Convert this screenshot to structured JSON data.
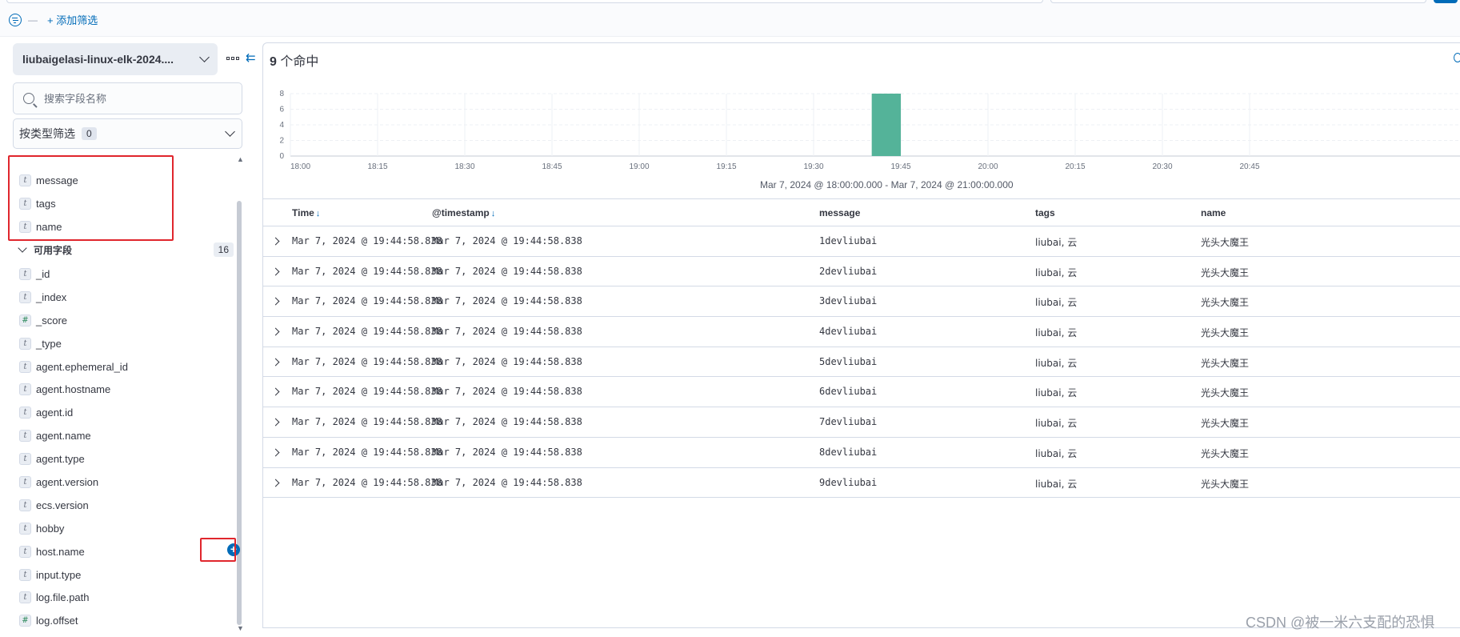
{
  "top": {
    "add_filter": "+ 添加筛选"
  },
  "sidebar": {
    "index_pattern": "liubaigelasi-linux-elk-2024....",
    "search_placeholder": "搜索字段名称",
    "type_filter_label": "按类型筛选",
    "type_filter_count": "0",
    "selected_fields": [
      {
        "type": "t",
        "name": "message"
      },
      {
        "type": "t",
        "name": "tags"
      },
      {
        "type": "t",
        "name": "name"
      }
    ],
    "available_header": "可用字段",
    "available_count": "16",
    "available_fields": [
      {
        "type": "t",
        "name": "_id"
      },
      {
        "type": "t",
        "name": "_index"
      },
      {
        "type": "#",
        "name": "_score"
      },
      {
        "type": "t",
        "name": "_type"
      },
      {
        "type": "t",
        "name": "agent.ephemeral_id"
      },
      {
        "type": "t",
        "name": "agent.hostname"
      },
      {
        "type": "t",
        "name": "agent.id"
      },
      {
        "type": "t",
        "name": "agent.name"
      },
      {
        "type": "t",
        "name": "agent.type"
      },
      {
        "type": "t",
        "name": "agent.version"
      },
      {
        "type": "t",
        "name": "ecs.version"
      },
      {
        "type": "t",
        "name": "hobby"
      },
      {
        "type": "t",
        "name": "host.name"
      },
      {
        "type": "t",
        "name": "input.type"
      },
      {
        "type": "t",
        "name": "log.file.path"
      },
      {
        "type": "#",
        "name": "log.offset"
      }
    ]
  },
  "main": {
    "hits_count": "9",
    "hits_label": " 个命中",
    "chart_range": "Mar 7, 2024 @ 18:00:00.000 - Mar 7, 2024 @ 21:00:00.000"
  },
  "chart_data": {
    "type": "bar",
    "x_ticks": [
      "18:00",
      "18:15",
      "18:30",
      "18:45",
      "19:00",
      "19:15",
      "19:30",
      "19:45",
      "20:00",
      "20:15",
      "20:30",
      "20:45"
    ],
    "y_ticks": [
      0,
      2,
      4,
      6,
      8
    ],
    "ylim": [
      0,
      8
    ],
    "bars": [
      {
        "x": "19:40",
        "value": 9
      }
    ],
    "color": "#54b399"
  },
  "table": {
    "columns": [
      {
        "label": "Time",
        "sortable": true
      },
      {
        "label": "@timestamp",
        "sortable": true
      },
      {
        "label": "message",
        "sortable": false
      },
      {
        "label": "tags",
        "sortable": false
      },
      {
        "label": "name",
        "sortable": false
      }
    ],
    "rows": [
      [
        "Mar 7, 2024 @ 19:44:58.838",
        "Mar 7, 2024 @ 19:44:58.838",
        "1devliubai",
        "liubai, 云",
        "光头大魔王"
      ],
      [
        "Mar 7, 2024 @ 19:44:58.838",
        "Mar 7, 2024 @ 19:44:58.838",
        "2devliubai",
        "liubai, 云",
        "光头大魔王"
      ],
      [
        "Mar 7, 2024 @ 19:44:58.838",
        "Mar 7, 2024 @ 19:44:58.838",
        "3devliubai",
        "liubai, 云",
        "光头大魔王"
      ],
      [
        "Mar 7, 2024 @ 19:44:58.838",
        "Mar 7, 2024 @ 19:44:58.838",
        "4devliubai",
        "liubai, 云",
        "光头大魔王"
      ],
      [
        "Mar 7, 2024 @ 19:44:58.838",
        "Mar 7, 2024 @ 19:44:58.838",
        "5devliubai",
        "liubai, 云",
        "光头大魔王"
      ],
      [
        "Mar 7, 2024 @ 19:44:58.838",
        "Mar 7, 2024 @ 19:44:58.838",
        "6devliubai",
        "liubai, 云",
        "光头大魔王"
      ],
      [
        "Mar 7, 2024 @ 19:44:58.838",
        "Mar 7, 2024 @ 19:44:58.838",
        "7devliubai",
        "liubai, 云",
        "光头大魔王"
      ],
      [
        "Mar 7, 2024 @ 19:44:58.838",
        "Mar 7, 2024 @ 19:44:58.838",
        "8devliubai",
        "liubai, 云",
        "光头大魔王"
      ],
      [
        "Mar 7, 2024 @ 19:44:58.838",
        "Mar 7, 2024 @ 19:44:58.838",
        "9devliubai",
        "liubai, 云",
        "光头大魔王"
      ]
    ]
  },
  "watermark": "CSDN @被一米六支配的恐惧",
  "colors": {
    "accent": "#006bb8",
    "bar": "#54b399",
    "highlight_box": "#e0262d"
  }
}
